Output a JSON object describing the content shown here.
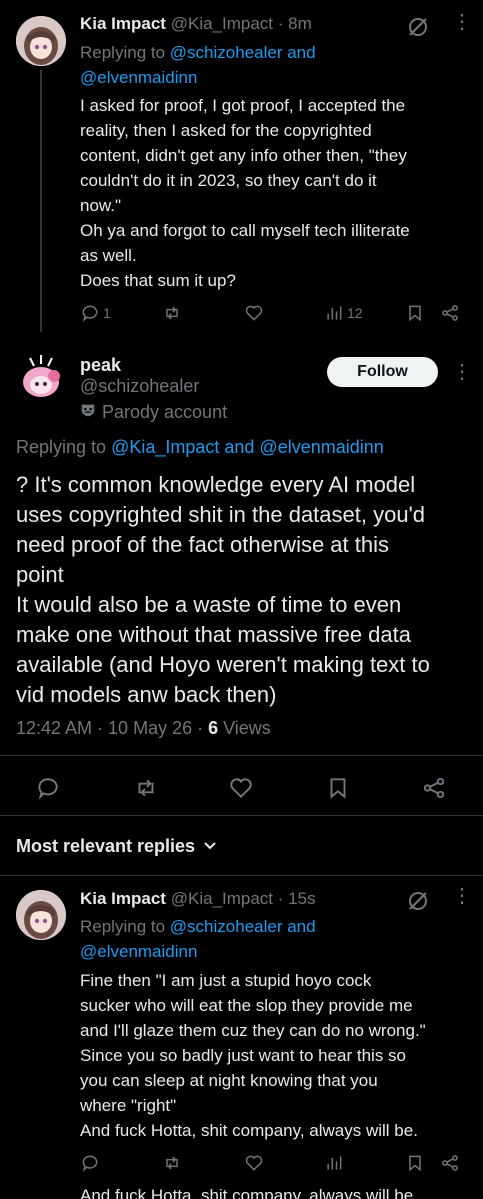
{
  "top_reply": {
    "name": "Kia Impact",
    "handle": "@Kia_Impact",
    "time": "8m",
    "replying_prefix": "Replying to",
    "replying_to": "@schizohealer and @elvenmaidinn",
    "replying_line1": "@schizohealer and",
    "replying_line2": "@elvenmaidinn",
    "body": "I asked for proof, I got proof, I accepted the\nreality, then I asked for the copyrighted\ncontent, didn't get any info other then, \"they\ncouldn't do it in 2023, so they can't do it\nnow.\"\nOh ya and forgot to call myself tech illiterate\nas well.\nDoes that sum it up?",
    "reply_count": "1",
    "views": "12"
  },
  "main_tweet": {
    "name": "peak",
    "handle": "@schizohealer",
    "parody_label": "Parody account",
    "follow_label": "Follow",
    "replying_prefix": "Replying to",
    "replying_to": "@Kia_Impact and @elvenmaidinn",
    "body": "? It's common knowledge every AI model\nuses copyrighted shit in the dataset, you'd\nneed proof of the fact otherwise at this\npoint\nIt would also be a waste of time to even\nmake one without that massive free data\navailable (and Hoyo weren't making text to\nvid models anw back then)",
    "timestamp": "12:42 AM · 10 May 26 · ",
    "views_count": "6",
    "views_label": " Views"
  },
  "replies_header": {
    "label": "Most relevant replies"
  },
  "bottom_reply": {
    "name": "Kia Impact",
    "handle": "@Kia_Impact",
    "time": "15s",
    "replying_prefix": "Replying to",
    "replying_line1": "@schizohealer and",
    "replying_line2": "@elvenmaidinn",
    "body": "Fine then \"I am just a stupid hoyo cock\nsucker who will eat the slop they provide me\nand I'll glaze them cuz they can do no wrong.\"\nSince you so badly just want to hear this so\nyou can sleep at night knowing that you\nwhere \"right\"\nAnd fuck Hotta, shit company, always will be."
  },
  "trailing_text": "And fuck Hotta, shit company, always will be.",
  "colors": {
    "background": "#000000",
    "text": "#e7e9ea",
    "muted": "#71767b",
    "link": "#1d9bf0",
    "divider": "#2f3336"
  }
}
